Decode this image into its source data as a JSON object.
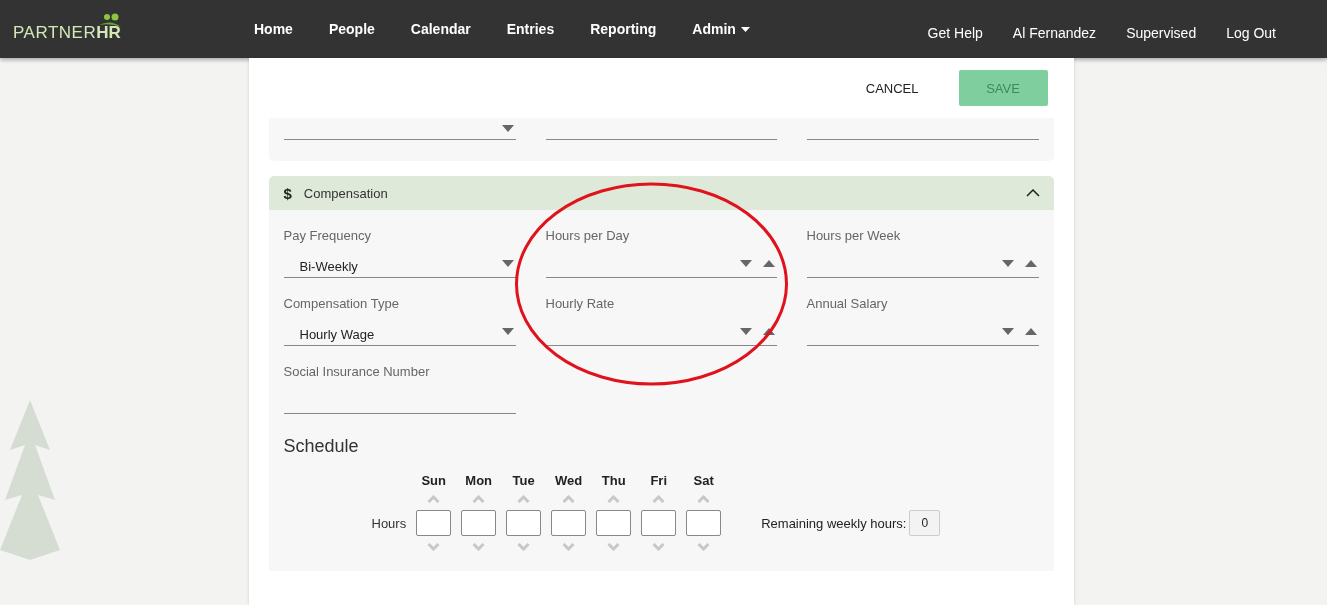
{
  "navbar": {
    "logo": {
      "light": "PARTNER",
      "bold": "HR"
    },
    "menu": [
      {
        "label": "Home",
        "dropdown": false
      },
      {
        "label": "People",
        "dropdown": false
      },
      {
        "label": "Calendar",
        "dropdown": false
      },
      {
        "label": "Entries",
        "dropdown": false
      },
      {
        "label": "Reporting",
        "dropdown": false
      },
      {
        "label": "Admin",
        "dropdown": true
      }
    ],
    "right_links": [
      "Get Help",
      "Al Fernandez",
      "Supervised",
      "Log Out"
    ]
  },
  "actions": {
    "cancel": {
      "label": "CANCEL"
    },
    "save": {
      "label": "SAVE",
      "disabled": true
    }
  },
  "previous_section": {
    "fields": [
      {
        "kind": "select"
      },
      {
        "kind": "text"
      },
      {
        "kind": "text"
      }
    ]
  },
  "compensation": {
    "icon": "$",
    "title": "Compensation",
    "expanded": true,
    "fields": [
      {
        "kind": "select",
        "label": "Pay Frequency",
        "value": "Bi-Weekly"
      },
      {
        "kind": "number",
        "label": "Hours per Day"
      },
      {
        "kind": "number",
        "label": "Hours per Week"
      },
      {
        "kind": "select",
        "label": "Compensation Type",
        "value": "Hourly Wage"
      },
      {
        "kind": "number",
        "label": "Hourly Rate"
      },
      {
        "kind": "number",
        "label": "Annual Salary"
      },
      {
        "kind": "text",
        "label": "Social Insurance Number"
      }
    ],
    "schedule": {
      "title": "Schedule",
      "row_label": "Hours",
      "days": [
        "Sun",
        "Mon",
        "Tue",
        "Wed",
        "Thu",
        "Fri",
        "Sat"
      ],
      "remaining_label": "Remaining weekly hours:",
      "remaining_value": "0"
    }
  }
}
